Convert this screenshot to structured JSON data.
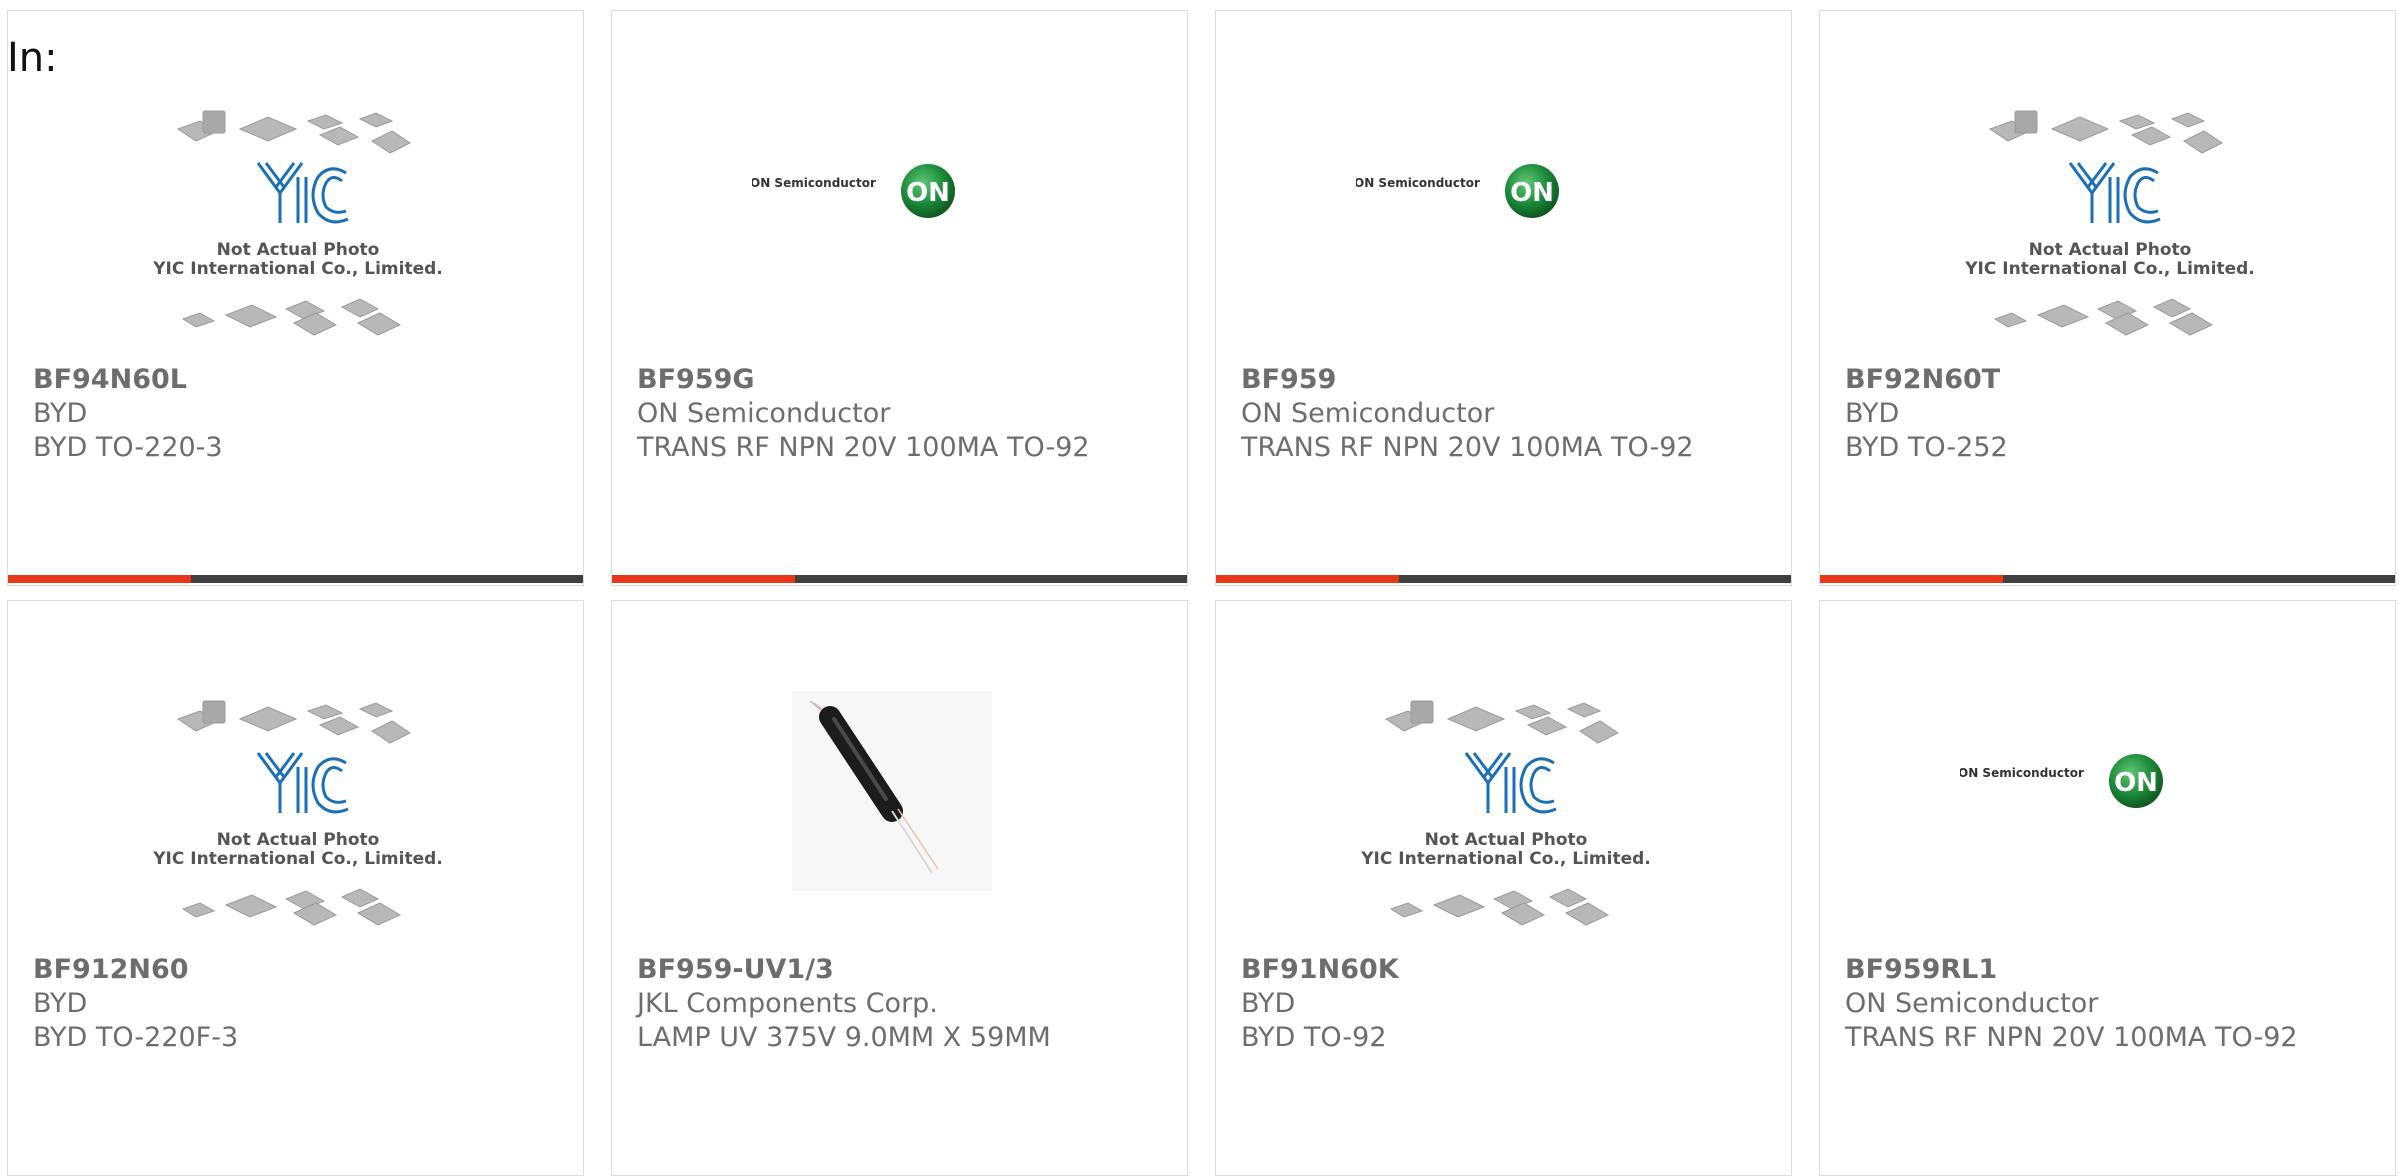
{
  "filter_label": "In:",
  "placeholder": {
    "line1": "Not Actual Photo",
    "line2": "YIC International Co., Limited."
  },
  "on_logo": {
    "wordmark": "ON Semiconductor",
    "badge": "ON"
  },
  "colors": {
    "accent": "#e8381a",
    "bar": "#404040",
    "text": "#6d6d6d",
    "yic_blue": "#1a6fb5",
    "on_green": "#1c8a3a"
  },
  "products": [
    {
      "part": "BF94N60L",
      "manufacturer": "BYD",
      "description": "BYD TO-220-3",
      "image": "yic-placeholder"
    },
    {
      "part": "BF959G",
      "manufacturer": "ON Semiconductor",
      "description": "TRANS RF NPN 20V 100MA TO-92",
      "image": "on-semi-logo"
    },
    {
      "part": "BF959",
      "manufacturer": "ON Semiconductor",
      "description": "TRANS RF NPN 20V 100MA TO-92",
      "image": "on-semi-logo"
    },
    {
      "part": "BF92N60T",
      "manufacturer": "BYD",
      "description": "BYD TO-252",
      "image": "yic-placeholder"
    },
    {
      "part": "BF912N60",
      "manufacturer": "BYD",
      "description": "BYD TO-220F-3",
      "image": "yic-placeholder"
    },
    {
      "part": "BF959-UV1/3",
      "manufacturer": "JKL Components Corp.",
      "description": "LAMP UV 375V 9.0MM X 59MM",
      "image": "uv-lamp-photo"
    },
    {
      "part": "BF91N60K",
      "manufacturer": "BYD",
      "description": "BYD TO-92",
      "image": "yic-placeholder"
    },
    {
      "part": "BF959RL1",
      "manufacturer": "ON Semiconductor",
      "description": "TRANS RF NPN 20V 100MA TO-92",
      "image": "on-semi-logo"
    }
  ]
}
